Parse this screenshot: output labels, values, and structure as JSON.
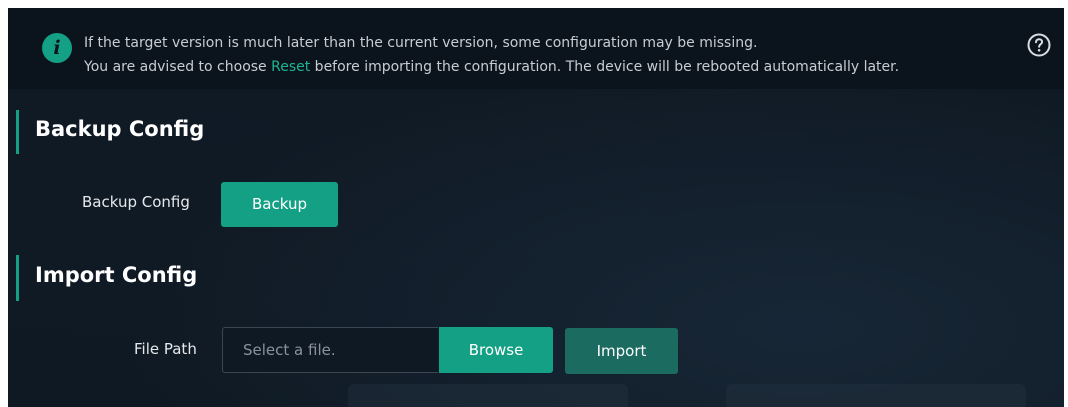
{
  "notice": {
    "icon": "info-icon",
    "line1": "If the target version is much later than the current version, some configuration may be missing.",
    "line2_before": "You are advised to choose ",
    "line2_link": "Reset",
    "line2_after": " before importing the configuration. The device will be rebooted automatically later.",
    "help_icon": "help-circle-icon"
  },
  "backup_section": {
    "title": "Backup Config",
    "field_label": "Backup Config",
    "button_label": "Backup"
  },
  "import_section": {
    "title": "Import Config",
    "field_label": "File Path",
    "file_placeholder": "Select a file.",
    "browse_label": "Browse",
    "import_label": "Import"
  },
  "colors": {
    "accent": "#14a085",
    "link": "#1fb395",
    "background": "#0f1923",
    "import_button": "#1b6b60"
  }
}
